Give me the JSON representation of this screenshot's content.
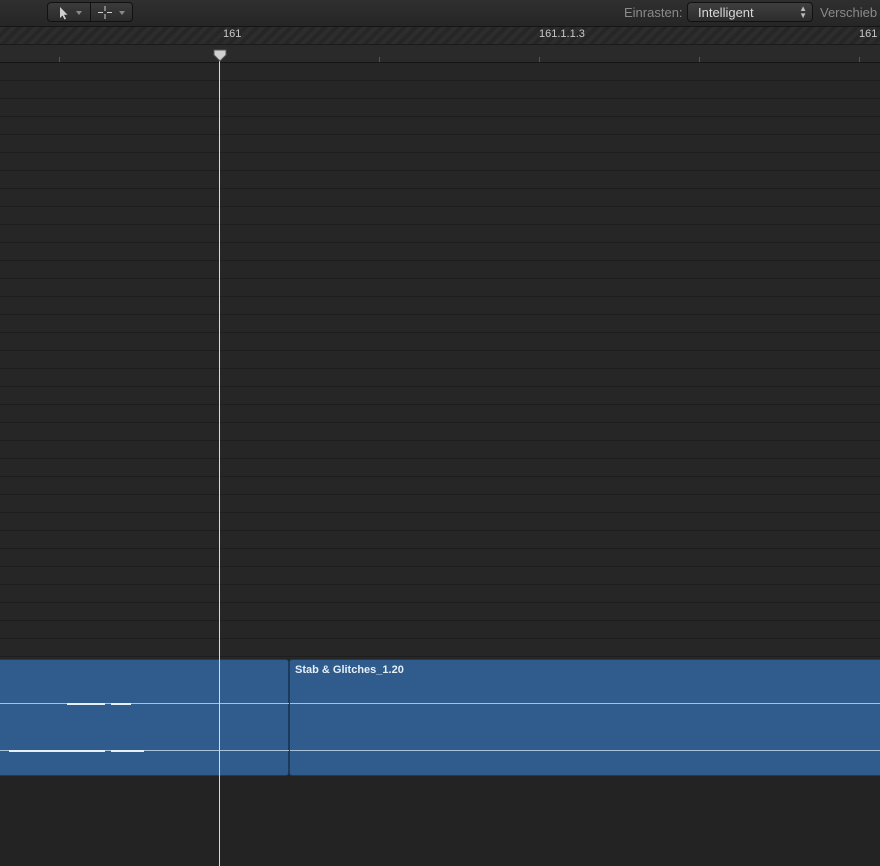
{
  "toolbar": {
    "pointer_tool": "pointer-icon",
    "second_tool": "crosshair-icon",
    "snap_label": "Einrasten:",
    "snap_value": "Intelligent",
    "drag_label": "Verschieb"
  },
  "ruler": {
    "markers": [
      "161",
      "161.1.1.3",
      "161"
    ]
  },
  "regions": [
    {
      "name": ""
    },
    {
      "name": "Stab & Glitches_1.20"
    }
  ]
}
